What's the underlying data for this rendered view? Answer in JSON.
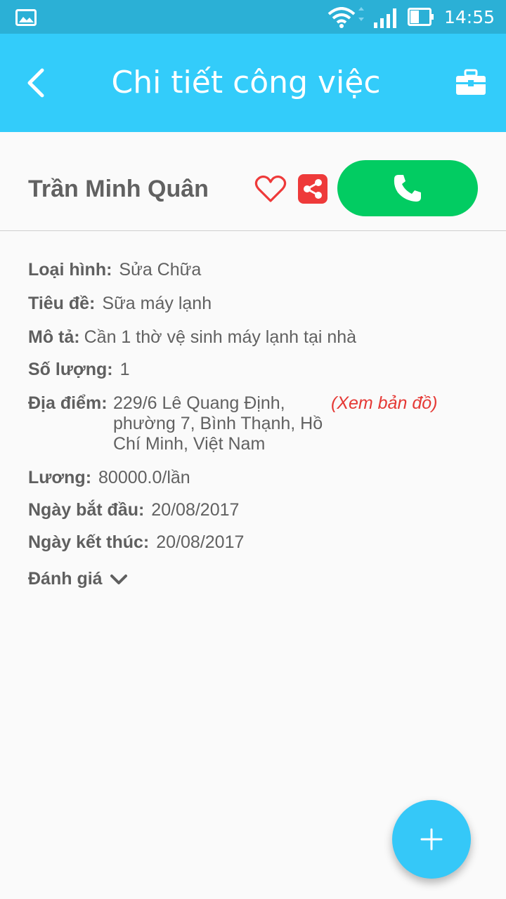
{
  "status_bar": {
    "time": "14:55",
    "icons": [
      "gallery-icon",
      "wifi-icon",
      "signal-icon",
      "battery-icon"
    ]
  },
  "app_bar": {
    "title": "Chi tiết công việc",
    "back_icon": "chevron-left-icon",
    "action_icon": "toolbox-icon",
    "color": "#33ccfa"
  },
  "header": {
    "name": "Trần Minh Quân",
    "favorite_icon": "heart-outline-icon",
    "share_icon": "share-icon",
    "call_icon": "phone-icon",
    "call_color": "#02cc62",
    "share_color": "#ee3a3a"
  },
  "details": {
    "type": {
      "label": "Loại hình:",
      "value": "Sửa Chữa"
    },
    "title": {
      "label": "Tiêu đề:",
      "value": "Sữa máy lạnh"
    },
    "description": {
      "label": "Mô tả:",
      "value": "Cần 1 thờ vệ sinh máy lạnh tại nhà"
    },
    "quantity": {
      "label": "Số lượng:",
      "value": "1"
    },
    "location": {
      "label": "Địa điểm:",
      "value": "229/6 Lê Quang Định, phường 7, Bình Thạnh, Hồ Chí Minh, Việt Nam",
      "map_link": "(Xem bản đồ)"
    },
    "salary": {
      "label": "Lương:",
      "value": "80000.0/lần"
    },
    "start_date": {
      "label": "Ngày bắt đầu:",
      "value": "20/08/2017"
    },
    "end_date": {
      "label": "Ngày kết thúc:",
      "value": "20/08/2017"
    },
    "rating": {
      "label": "Đánh giá"
    }
  },
  "fab": {
    "icon": "plus-icon"
  }
}
